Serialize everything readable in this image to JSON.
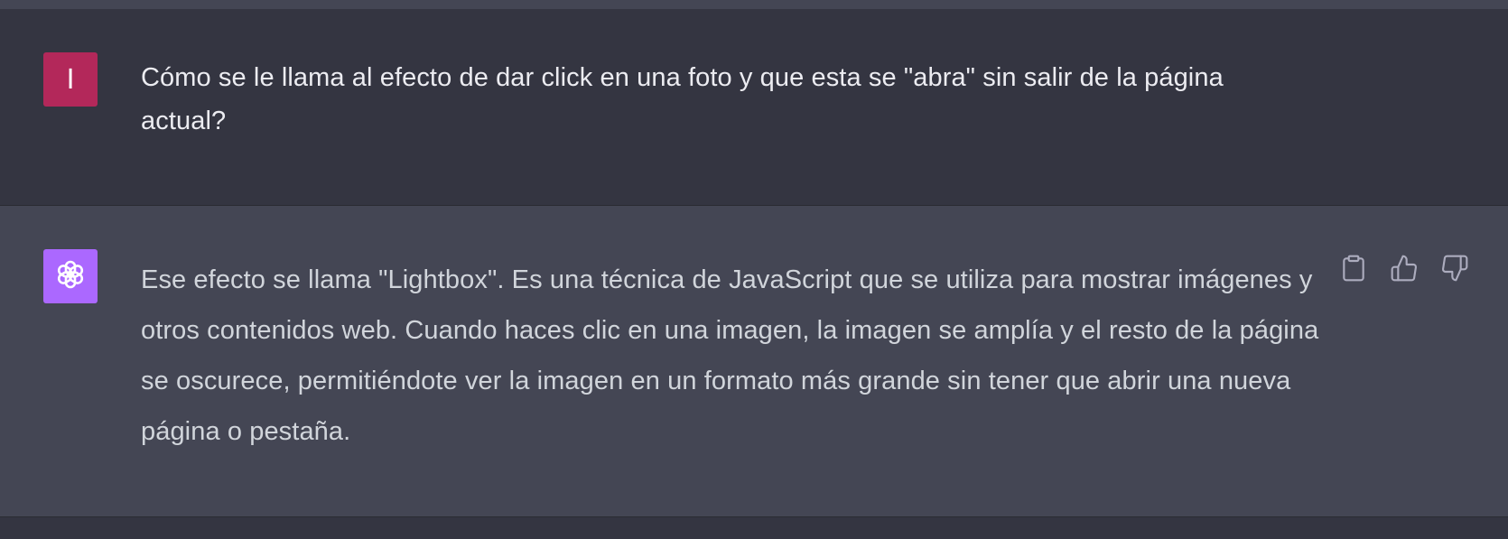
{
  "conversation": {
    "user_message": {
      "avatar_initial": "I",
      "text": "Cómo se le llama al efecto de dar click en una foto y que esta se \"abra\" sin salir de la página actual?"
    },
    "assistant_message": {
      "text": "Ese efecto se llama \"Lightbox\". Es una técnica de JavaScript que se utiliza para mostrar imágenes y otros contenidos web. Cuando haces clic en una imagen, la imagen se amplía y el resto de la página se oscurece, permitiéndote ver la imagen en un formato más grande sin tener que abrir una nueva página o pestaña."
    },
    "actions": {
      "copy_icon": "clipboard-icon",
      "like_icon": "thumbs-up-icon",
      "dislike_icon": "thumbs-down-icon"
    }
  },
  "colors": {
    "user_bg": "#343541",
    "assistant_bg": "#444654",
    "user_avatar": "#b3285a",
    "assistant_avatar": "#ab68ff"
  }
}
